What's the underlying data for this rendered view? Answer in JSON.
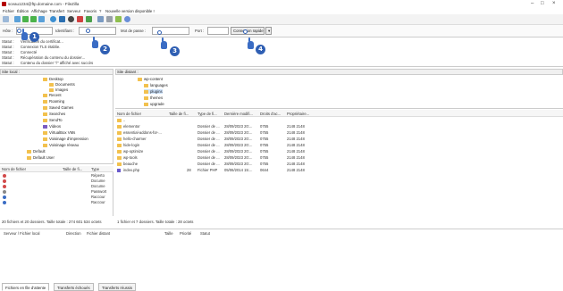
{
  "window": {
    "title": "sceau1234@ftp.domaine.com - FileZilla"
  },
  "menu": [
    "Fichier",
    "Édition",
    "Affichage",
    "Transfert",
    "Serveur",
    "Favoris",
    "?",
    "Nouvelle version disponible !"
  ],
  "quickconnect": {
    "host_label": "Hôte :",
    "user_label": "Identifiant :",
    "pass_label": "Mot de passe :",
    "port_label": "Port :",
    "connect_label": "Connexion rapide"
  },
  "log": [
    {
      "label": "Statut :",
      "text": "Vérification du certificat..."
    },
    {
      "label": "Statut :",
      "text": "Connexion TLS établie."
    },
    {
      "label": "Statut :",
      "text": "Connecté"
    },
    {
      "label": "Statut :",
      "text": "Récupération du contenu du dossier..."
    },
    {
      "label": "Statut :",
      "text": "Contenu du dossier \"/\" affiché avec succès"
    }
  ],
  "local": {
    "site_label": "Site local :",
    "tree": [
      "Desktop",
      "Documents",
      "Images",
      "Recent",
      "Roaming",
      "Saved Games",
      "Searches",
      "SendTo",
      "Videos",
      "VirtualBox VMs",
      "Voisinage d'impression",
      "Voisinage réseau",
      "Default",
      "Default User"
    ],
    "columns": [
      "Nom de fichier",
      "Taille de fi...",
      "Type"
    ],
    "rows": [
      {
        "name": "",
        "size": "",
        "type": "Réperto"
      },
      {
        "name": "",
        "size": "",
        "type": "Docume"
      },
      {
        "name": "",
        "size": "",
        "type": "Docume"
      },
      {
        "name": "",
        "size": "",
        "type": "Passwort"
      },
      {
        "name": "",
        "size": "",
        "type": "Raccour"
      },
      {
        "name": "",
        "size": "",
        "type": "Raccour"
      }
    ],
    "status": "20 fichiers et 20 dossiers. Taille totale : 274 601 534 octets"
  },
  "remote": {
    "site_label": "Site distant :",
    "tree": [
      "wp-content",
      "languages",
      "plugins",
      "themes",
      "upgrade"
    ],
    "columns": [
      "Nom de fichier",
      "Taille de fi...",
      "Type de fi...",
      "Dernière modifi...",
      "Droits d'ac...",
      "Propriétaire..."
    ],
    "rows": [
      {
        "name": "..",
        "size": "",
        "type": "",
        "date": "",
        "perm": "",
        "owner": ""
      },
      {
        "name": "elementor",
        "size": "",
        "type": "Dossier de ...",
        "date": "28/09/2023 20:...",
        "perm": "0755",
        "owner": "2148 2148"
      },
      {
        "name": "essential-addons-for-...",
        "size": "",
        "type": "Dossier de ...",
        "date": "28/09/2023 20:...",
        "perm": "0755",
        "owner": "2148 2148"
      },
      {
        "name": "hello-charmer",
        "size": "",
        "type": "Dossier de ...",
        "date": "28/09/2023 20:...",
        "perm": "0755",
        "owner": "2148 2148"
      },
      {
        "name": "hide-login",
        "size": "",
        "type": "Dossier de ...",
        "date": "28/09/2023 20:...",
        "perm": "0755",
        "owner": "2148 2148"
      },
      {
        "name": "wp-optimize",
        "size": "",
        "type": "Dossier de ...",
        "date": "28/09/2023 20:...",
        "perm": "0755",
        "owner": "2148 2148"
      },
      {
        "name": "wp-tools",
        "size": "",
        "type": "Dossier de ...",
        "date": "28/09/2023 20:...",
        "perm": "0755",
        "owner": "2148 2148"
      },
      {
        "name": "beauche",
        "size": "",
        "type": "Dossier de ...",
        "date": "28/09/2023 20:...",
        "perm": "0755",
        "owner": "2148 2148"
      },
      {
        "name": "index.php",
        "size": "28",
        "type": "Fichier PHP",
        "date": "05/06/2014 15:...",
        "perm": "0644",
        "owner": "2148 2148"
      }
    ],
    "status": "1 fichier et 7 dossiers. Taille totale : 28 octets"
  },
  "queue": {
    "columns": [
      "Serveur / Fichier local",
      "Direction",
      "Fichier distant",
      "Taille",
      "Priorité",
      "Statut"
    ]
  },
  "tabs": [
    "Fichiers en file d'attente",
    "Transferts échoués",
    "Transferts réussis"
  ],
  "markers": [
    "1",
    "2",
    "3",
    "4"
  ],
  "colors": {
    "accent": "#2f5fb3",
    "folder": "#f2c14e",
    "selected": "#cde3ff"
  }
}
